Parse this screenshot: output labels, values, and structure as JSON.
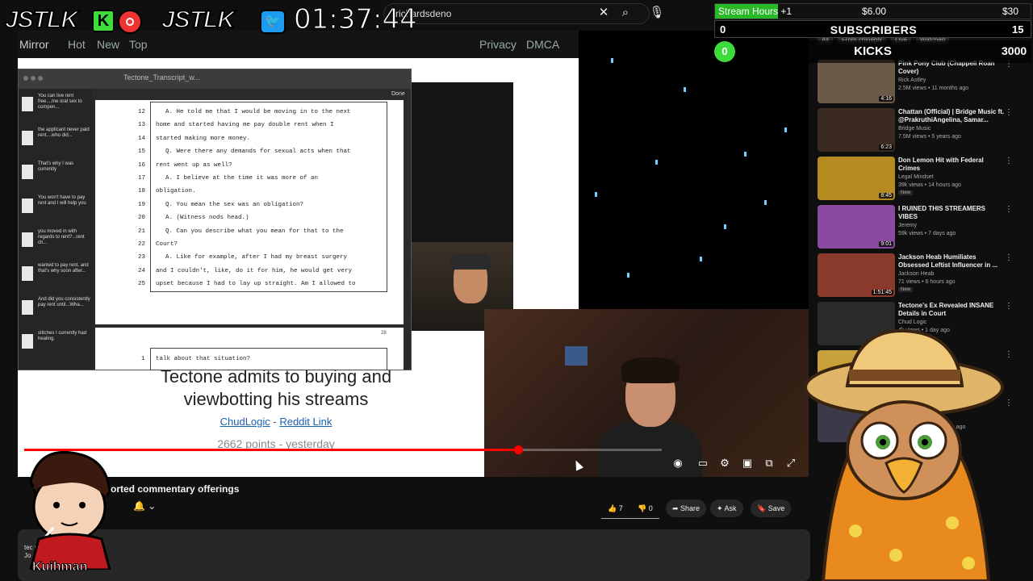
{
  "overlay": {
    "logo_left": "JSTLK",
    "kick_badge": "K",
    "logo_right": "JSTLK",
    "twitter_badge": "🐦",
    "timer": "01:37:44",
    "stream_hours_label": "Stream Hours",
    "stream_hours_increment": "+1",
    "stream_hours_mid": "$6.00",
    "stream_hours_right": "$30",
    "subscribers_count": "0",
    "subscribers_label": "SUBSCRIBERS",
    "subscribers_goal": "15",
    "kicks_count": "0",
    "kicks_label": "KICKS",
    "kicks_goal": "3000",
    "streamer_name": "Kuihman"
  },
  "yt_header": {
    "search_text": "richardsdeno"
  },
  "reddit": {
    "nav_logo": "Mirror",
    "nav_hot": "Hot",
    "nav_new": "New",
    "nav_top": "Top",
    "nav_privacy": "Privacy",
    "nav_dmca": "DMCA",
    "post_title": "Tectone admits to buying and viewbotting his streams",
    "link_a": "ChudLogic",
    "link_sep": " - ",
    "link_b": "Reddit Link",
    "meta": "2662 points - yesterday"
  },
  "pdf": {
    "filename": "Tectone_Transcript_w...",
    "done": "Done",
    "sidebar_items": [
      "You can live rent free....me oral sex to compen...",
      "the applicant never paid rent....who did...",
      "That's why I was currently",
      "You won't have to pay rent and I will help you",
      "you moved in with regards to rent?...rent ch...",
      "wanted to pay rent, and that's why soon after...",
      "And did you consistently pay rent until...Wha...",
      "stitches I currently had healing."
    ],
    "lines": [
      {
        "n": "12",
        "t": "A.   He told me that I would be moving in to the next"
      },
      {
        "n": "13",
        "t": "home and started having me pay double rent when I"
      },
      {
        "n": "14",
        "t": "started making more money."
      },
      {
        "n": "15",
        "t": "Q.   Were there any demands for sexual acts when that"
      },
      {
        "n": "16",
        "t": "rent went up as well?"
      },
      {
        "n": "17",
        "t": "A.   I believe at the time it was more of an"
      },
      {
        "n": "18",
        "t": "obligation."
      },
      {
        "n": "19",
        "t": "Q.   You mean the sex was an obligation?"
      },
      {
        "n": "20",
        "t": "A.   (Witness nods head.)"
      },
      {
        "n": "21",
        "t": "Q.   Can you describe what you mean for that to the"
      },
      {
        "n": "22",
        "t": "Court?"
      },
      {
        "n": "23",
        "t": "A.   Like for example, after I had my breast surgery"
      },
      {
        "n": "24",
        "t": "and I couldn't, like, do it for him, he would get very"
      },
      {
        "n": "25",
        "t": "upset because I had to lay up straight.  Am I allowed to"
      }
    ],
    "page2_num": "28",
    "page2_line_num": "1",
    "page2_line": "talk about that situation?"
  },
  "below_video": {
    "title": "orted commentary offerings",
    "like_count": "7",
    "dislike_count": "0",
    "share": "Share",
    "ask": "Ask",
    "save": "Save",
    "desc_line1": "tec                          mentary offerings",
    "desc_line2": "Jo                              erks:"
  },
  "sidebar": {
    "chips": [
      "All",
      "From chloeplx",
      "Live",
      "Watched"
    ],
    "recs": [
      {
        "title": "Pink Pony Club (Chappell Roan Cover)",
        "channel": "Rick Astley",
        "meta": "2.5M views • 11 months ago",
        "dur": "4:16",
        "color": "#6b5a48",
        "new": ""
      },
      {
        "title": "Chattan (Official) | Bridge Music ft. @PrakruthiAngelina, Samar...",
        "channel": "Bridge Music",
        "meta": "7.5M views • 5 years ago",
        "dur": "6:23",
        "color": "#3a2a20",
        "new": ""
      },
      {
        "title": "Don Lemon Hit with Federal Crimes",
        "channel": "Legal Mindset",
        "meta": "39k views • 14 hours ago",
        "dur": "8:45",
        "color": "#b58a1e",
        "new": "New"
      },
      {
        "title": "I RUINED THIS STREAMERS VIBES",
        "channel": "Jeremy",
        "meta": "59k views • 7 days ago",
        "dur": "9:01",
        "color": "#8a4aa0",
        "new": ""
      },
      {
        "title": "Jackson Heab Humiliates Obsessed Leftist Influencer in ...",
        "channel": "Jackson Heab",
        "meta": "71 views • 6 hours ago",
        "dur": "1:51:45",
        "color": "#8a3a2a",
        "new": "New"
      },
      {
        "title": "Tectone's Ex Revealed INSANE Details in Court",
        "channel": "Chud Logic",
        "meta": "4k views • 1 day ago",
        "dur": "",
        "color": "#2a2a2a",
        "new": ""
      },
      {
        "title": "... At ... heating",
        "channel": "",
        "meta": "",
        "dur": "",
        "color": "#c9a13a",
        "new": ""
      },
      {
        "title": "... Share Their",
        "channel": "Paz",
        "meta": "163k views • 5 months ago",
        "dur": "11:15",
        "color": "#3a3a4a",
        "new": ""
      }
    ]
  },
  "colors": {
    "kick_green": "#3ddc3d",
    "yt_red": "#ff0000",
    "link_blue": "#1a61b0"
  }
}
